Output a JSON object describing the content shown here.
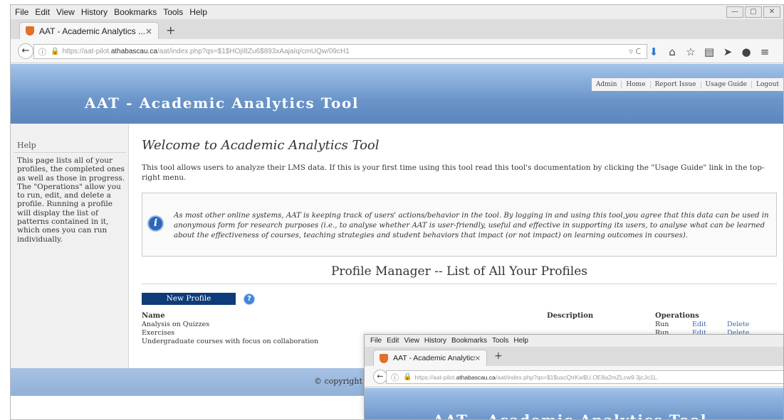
{
  "browser": {
    "menu": [
      "File",
      "Edit",
      "View",
      "History",
      "Bookmarks",
      "Tools",
      "Help"
    ],
    "window_controls": [
      "—",
      "▢",
      "✕"
    ],
    "tab_title": "AAT - Academic Analytics ...",
    "tab_close": "×",
    "new_tab": "+",
    "url_prefix": "https://aat-pilot.",
    "url_domain": "athabascau.ca",
    "url_path": "/aat/index.php?qs=$1$HOjI8Zu6$893xAajaIq/cmUQw/09cH1",
    "refresh": "▿ C",
    "back": "←",
    "nav_icons": [
      {
        "name": "download-icon",
        "glyph": "⬇"
      },
      {
        "name": "home-icon",
        "glyph": "⌂"
      },
      {
        "name": "bookmark-star-icon",
        "glyph": "☆"
      },
      {
        "name": "reading-list-icon",
        "glyph": "▤"
      },
      {
        "name": "send-icon",
        "glyph": "➤"
      },
      {
        "name": "chat-icon",
        "glyph": "●"
      },
      {
        "name": "menu-icon",
        "glyph": "≡"
      }
    ]
  },
  "site": {
    "title": "AAT - Academic Analytics Tool",
    "top_menu": [
      "Admin",
      "Home",
      "Report Issue",
      "Usage Guide",
      "Logout"
    ]
  },
  "sidebar": {
    "heading": "Help",
    "text": "This page lists all of your profiles, the completed ones as well as those in progress. The \"Operations\" allow you to run, edit, and delete a profile. Running a profile will display the list of patterns contained in it, which ones you can run individually."
  },
  "main": {
    "welcome": "Welcome to Academic Analytics Tool",
    "intro": "This tool allows users to analyze their LMS data. If this is your first time using this tool read this tool's documentation by clicking the \"Usage Guide\" link in the top-right menu.",
    "notice": "As most other online systems, AAT is keeping track of users' actions/behavior in the tool. By logging in and using this tool,you agree that this data can be used in anonymous form for research purposes (i.e., to analyse whether AAT is user-friendly, useful and effective in supporting its users, to analyse what can be learned about the effectiveness of courses, teaching strategies and student behaviors that impact (or not impact) on learning outcomes in courses).",
    "profile_manager_title": "Profile Manager -- List of All Your Profiles",
    "new_profile_label": "New Profile",
    "help_badge": "?",
    "columns": {
      "name": "Name",
      "description": "Description",
      "operations": "Operations"
    },
    "profiles": [
      {
        "name": "Analysis on Quizzes",
        "run": "Run",
        "edit": "Edit",
        "delete": "Delete"
      },
      {
        "name": "Exercises",
        "run": "Run",
        "edit": "Edit",
        "delete": "Delete"
      },
      {
        "name": "Undergraduate courses with focus on collaboration",
        "run": "",
        "edit": "",
        "delete": ""
      }
    ]
  },
  "footer": {
    "copyright": "© copyright"
  },
  "second_window": {
    "menu": [
      "File",
      "Edit",
      "View",
      "History",
      "Bookmarks",
      "Tools",
      "Help"
    ],
    "tab_title": "AAT - Academic Analytics ...",
    "tab_close": "×",
    "new_tab": "+",
    "url_prefix": "https://aat-pilot.",
    "url_domain": "athabascau.ca",
    "url_path": "/aat/index.php?qs=$1$uscQtrKw$U.OE8a2mZLcw9.3jcJo1L.",
    "site_title": "AAT - Academic Analytics Tool"
  }
}
